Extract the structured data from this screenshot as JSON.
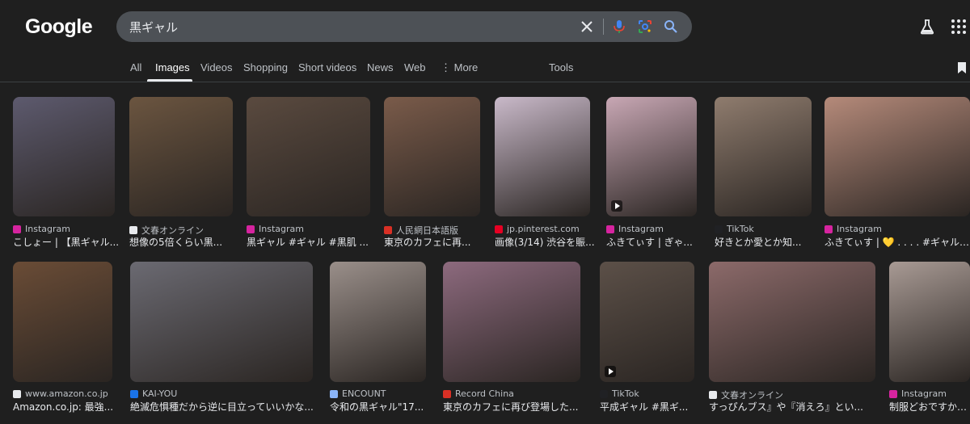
{
  "brand": {
    "logo_text": "Google"
  },
  "search": {
    "query": "黒ギャル"
  },
  "header_icons": [
    "clear-icon",
    "mic-icon",
    "lens-icon",
    "search-icon",
    "labs-icon",
    "apps-icon"
  ],
  "tabs": [
    {
      "label": "All",
      "active": false
    },
    {
      "label": "Images",
      "active": true
    },
    {
      "label": "Videos",
      "active": false
    },
    {
      "label": "Shopping",
      "active": false
    },
    {
      "label": "Short videos",
      "active": false
    },
    {
      "label": "News",
      "active": false
    },
    {
      "label": "Web",
      "active": false
    },
    {
      "label": "⋮ More",
      "active": false
    },
    {
      "label": "Tools",
      "active": false
    }
  ],
  "results": [
    {
      "source": "Instagram",
      "title": "こしょー | 【黒ギャル...",
      "fav": "#d6249f",
      "thumb": "#5d5a6e",
      "video": false
    },
    {
      "source": "文春オンライン",
      "title": "想像の5倍くらい黒...",
      "fav": "#e8eaed",
      "thumb": "#6b5540",
      "video": false
    },
    {
      "source": "Instagram",
      "title": "黒ギャル #ギャル #黒肌 ...",
      "fav": "#d6249f",
      "thumb": "#5a4a3f",
      "video": false
    },
    {
      "source": "人民網日本語版",
      "title": "東京のカフェに再...",
      "fav": "#d93025",
      "thumb": "#7a5b4a",
      "video": false
    },
    {
      "source": "jp.pinterest.com",
      "title": "画像(3/14) 渋谷を賑...",
      "fav": "#e60023",
      "thumb": "#c9b9c9",
      "video": false
    },
    {
      "source": "Instagram",
      "title": "ふきてぃす | ぎゃ...",
      "fav": "#d6249f",
      "thumb": "#c8a7b4",
      "video": true
    },
    {
      "source": "TikTok",
      "title": "好きとか愛とか知...",
      "fav": "#202124",
      "thumb": "#8f7c6e",
      "video": false
    },
    {
      "source": "Instagram",
      "title": "ふきてぃす | 💛 . . . . #ギャル#黒ギャ",
      "fav": "#d6249f",
      "thumb": "#b58a7a",
      "video": false
    },
    {
      "source": "www.amazon.co.jp",
      "title": "Amazon.co.jp: 最強...",
      "fav": "#e8eaed",
      "thumb": "#6a4c36",
      "video": false
    },
    {
      "source": "KAI-YOU",
      "title": "絶滅危惧種だから逆に目立っていいかな...",
      "fav": "#1a73e8",
      "thumb": "#6b6a72",
      "video": false
    },
    {
      "source": "ENCOUNT",
      "title": "令和の黒ギャル\"17...",
      "fav": "#8ab4f8",
      "thumb": "#9a8f8a",
      "video": false
    },
    {
      "source": "Record China",
      "title": "東京のカフェに再び登場した...",
      "fav": "#d93025",
      "thumb": "#8d6a7e",
      "video": false
    },
    {
      "source": "TikTok",
      "title": "平成ギャル #黒ギ...",
      "fav": "#202124",
      "thumb": "#5c5048",
      "video": true
    },
    {
      "source": "文春オンライン",
      "title": "すっぴんブス』や『消えろ』とい...",
      "fav": "#e8eaed",
      "thumb": "#8c6a6a",
      "video": false
    },
    {
      "source": "Instagram",
      "title": "制服どおですか？...",
      "fav": "#d6249f",
      "thumb": "#a89a94",
      "video": false
    }
  ]
}
